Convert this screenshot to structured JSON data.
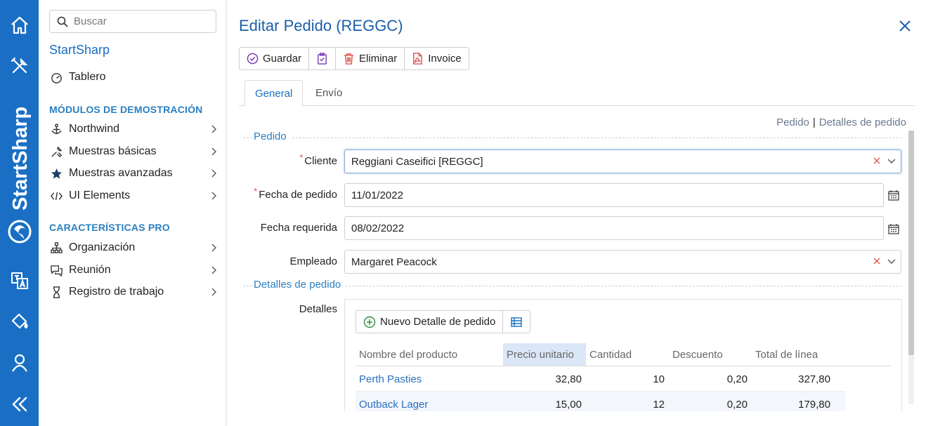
{
  "colors": {
    "rail": "#1a6fc4",
    "accent": "#2a7fc0",
    "title": "#1a5ea8",
    "required": "#d9534f"
  },
  "rail": {
    "brand": "StartSharp",
    "icons": [
      "home-icon",
      "tools-icon",
      "translate-icon",
      "paint-bucket-icon",
      "user-icon",
      "collapse-icon"
    ]
  },
  "sidebar": {
    "search_placeholder": "Buscar",
    "title": "StartSharp",
    "dashboard": "Tablero",
    "section_demo": "MÓDULOS DE DEMOSTRACIÓN",
    "demo_items": [
      {
        "label": "Northwind",
        "icon": "anchor-icon"
      },
      {
        "label": "Muestras básicas",
        "icon": "wrench-icon"
      },
      {
        "label": "Muestras avanzadas",
        "icon": "star-icon"
      },
      {
        "label": "UI Elements",
        "icon": "code-icon"
      }
    ],
    "section_pro": "CARACTERÍSTICAS PRO",
    "pro_items": [
      {
        "label": "Organización",
        "icon": "sitemap-icon"
      },
      {
        "label": "Reunión",
        "icon": "comments-icon"
      },
      {
        "label": "Registro de trabajo",
        "icon": "hourglass-icon"
      }
    ]
  },
  "dialog": {
    "title": "Editar Pedido (REGGC)",
    "toolbar": {
      "save": "Guardar",
      "delete": "Eliminar",
      "invoice": "Invoice"
    },
    "tabs": [
      "General",
      "Envío"
    ],
    "links": {
      "order": "Pedido",
      "sep": "|",
      "details": "Detalles de pedido"
    },
    "category_order": "Pedido",
    "category_details": "Detalles de pedido",
    "fields": {
      "customer": {
        "label": "Cliente",
        "value": "Reggiani Caseifici [REGGC]",
        "required": "*"
      },
      "order_date": {
        "label": "Fecha de pedido",
        "value": "11/01/2022",
        "required": "*"
      },
      "required_date": {
        "label": "Fecha requerida",
        "value": "08/02/2022"
      },
      "employee": {
        "label": "Empleado",
        "value": "Margaret Peacock"
      },
      "details": {
        "label": "Detalles"
      }
    },
    "grid": {
      "new_button": "Nuevo Detalle de pedido",
      "columns": [
        "Nombre del producto",
        "Precio unitario",
        "Cantidad",
        "Descuento",
        "Total de línea"
      ],
      "rows": [
        {
          "product": "Perth Pasties",
          "price": "32,80",
          "qty": "10",
          "discount": "0,20",
          "total": "327,80"
        },
        {
          "product": "Outback Lager",
          "price": "15,00",
          "qty": "12",
          "discount": "0,20",
          "total": "179,80"
        }
      ]
    }
  }
}
